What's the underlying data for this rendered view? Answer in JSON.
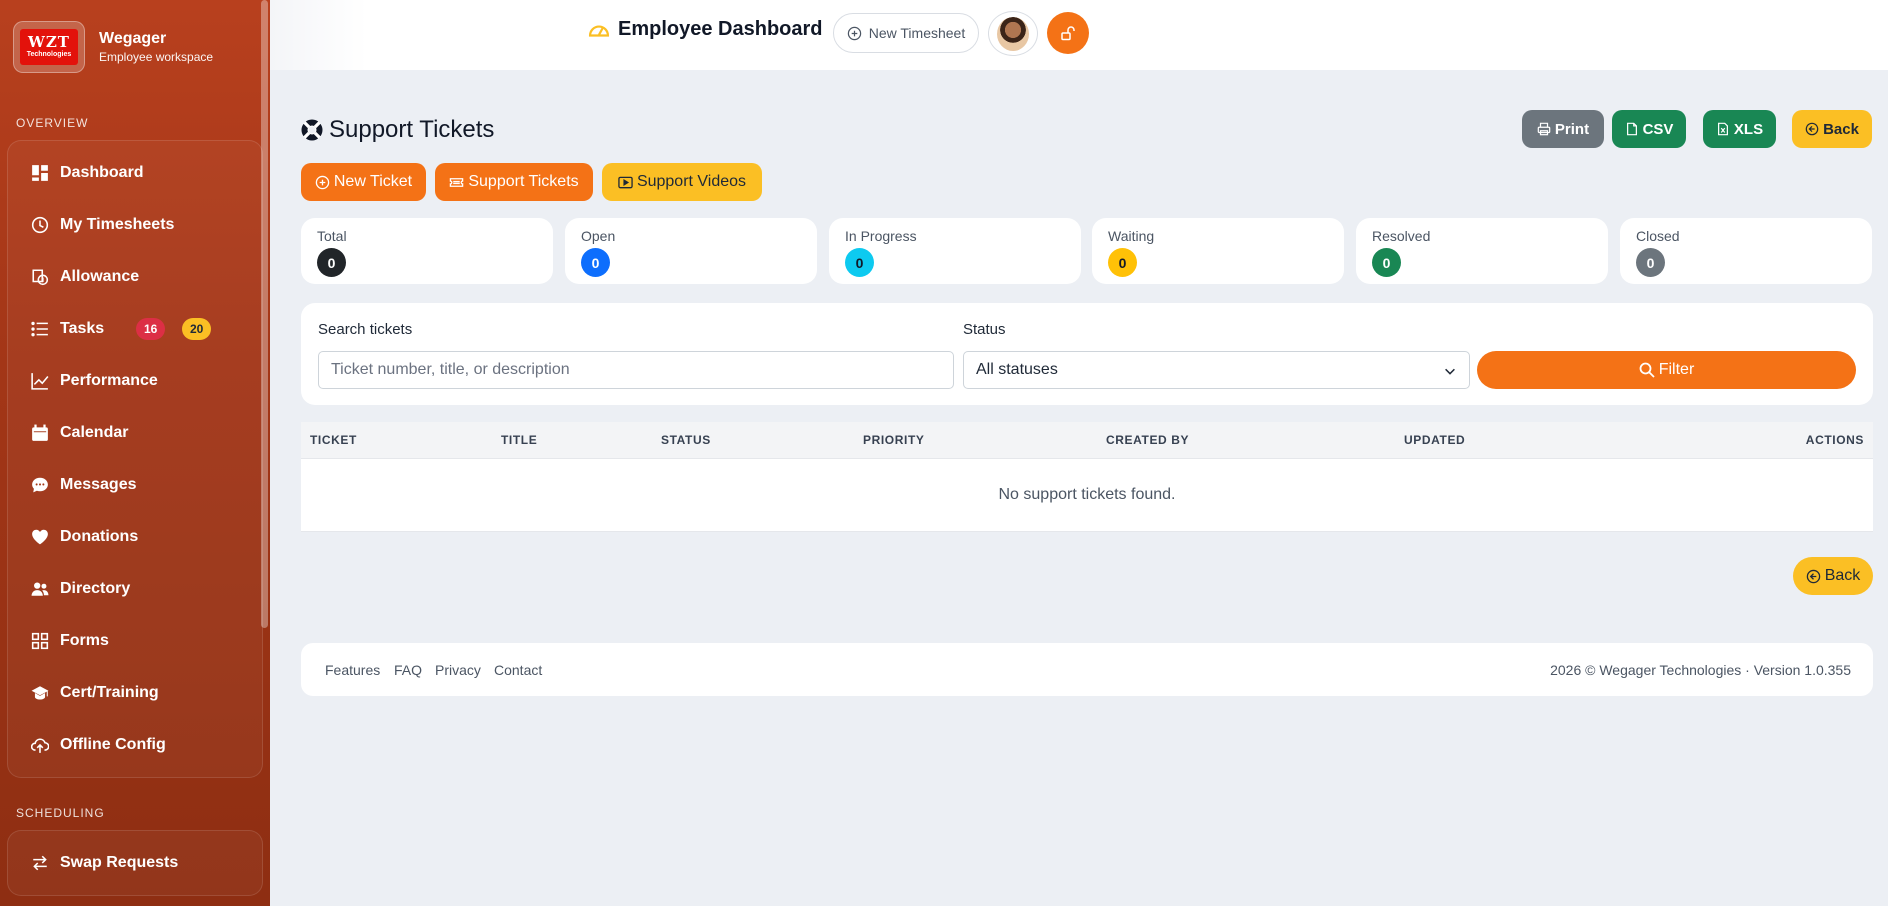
{
  "brand": {
    "logo_line1": "WZT",
    "logo_line2": "Technologies",
    "name": "Wegager",
    "subtitle": "Employee workspace"
  },
  "sidebar": {
    "sections": [
      {
        "label": "OVERVIEW"
      },
      {
        "label": "SCHEDULING"
      }
    ],
    "overview_items": [
      {
        "label": "Dashboard",
        "icon": "dashboard-icon"
      },
      {
        "label": "My Timesheets",
        "icon": "clock-icon"
      },
      {
        "label": "Allowance",
        "icon": "allowance-icon"
      },
      {
        "label": "Tasks",
        "icon": "list-icon",
        "badges": [
          "16",
          "20"
        ]
      },
      {
        "label": "Performance",
        "icon": "graph-icon"
      },
      {
        "label": "Calendar",
        "icon": "calendar-icon"
      },
      {
        "label": "Messages",
        "icon": "chat-icon"
      },
      {
        "label": "Donations",
        "icon": "heart-icon"
      },
      {
        "label": "Directory",
        "icon": "people-icon"
      },
      {
        "label": "Forms",
        "icon": "forms-icon"
      },
      {
        "label": "Cert/Training",
        "icon": "mortarboard-icon"
      },
      {
        "label": "Offline Config",
        "icon": "cloud-upload-icon"
      }
    ],
    "scheduling_items": [
      {
        "label": "Swap Requests",
        "icon": "swap-icon"
      }
    ]
  },
  "topbar": {
    "title": "Employee Dashboard",
    "new_timesheet": "New Timesheet"
  },
  "page": {
    "title": "Support Tickets",
    "print": "Print",
    "csv": "CSV",
    "xls": "XLS",
    "back": "Back",
    "actions": {
      "new_ticket": "New Ticket",
      "support_tickets": "Support Tickets",
      "support_videos": "Support Videos"
    }
  },
  "stats": [
    {
      "label": "Total",
      "value": "0",
      "color": "#212529"
    },
    {
      "label": "Open",
      "value": "0",
      "color": "#0d6efd"
    },
    {
      "label": "In Progress",
      "value": "0",
      "color": "#0dcaf0"
    },
    {
      "label": "Waiting",
      "value": "0",
      "color": "#ffc107"
    },
    {
      "label": "Resolved",
      "value": "0",
      "color": "#198754"
    },
    {
      "label": "Closed",
      "value": "0",
      "color": "#6c757d"
    }
  ],
  "filter": {
    "search_label": "Search tickets",
    "search_placeholder": "Ticket number, title, or description",
    "status_label": "Status",
    "status_value": "All statuses",
    "button": "Filter"
  },
  "table": {
    "columns": [
      "TICKET",
      "TITLE",
      "STATUS",
      "PRIORITY",
      "CREATED BY",
      "UPDATED",
      "ACTIONS"
    ],
    "empty": "No support tickets found."
  },
  "footer": {
    "links": [
      "Features",
      "FAQ",
      "Privacy",
      "Contact"
    ],
    "copyright": "2026 © Wegager Technologies · Version 1.0.355"
  },
  "colors": {
    "accent": "#f47216",
    "warning": "#fbbf24",
    "success": "#198754",
    "secondary": "#6c757d",
    "sidebar": "#a33617"
  }
}
